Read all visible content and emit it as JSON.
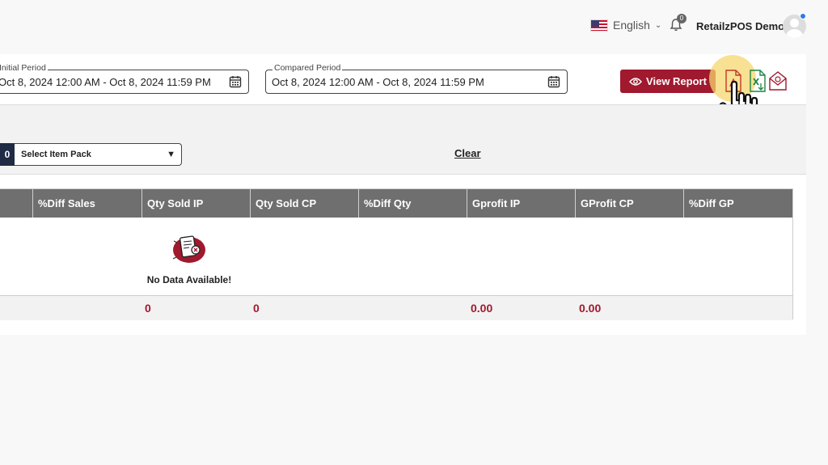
{
  "header": {
    "language": "English",
    "notifications_count": "0",
    "user_name": "RetailzPOS Demo"
  },
  "period": {
    "initial_label": "Initial Period",
    "initial_value": "Oct 8, 2024 12:00 AM - Oct 8, 2024 11:59 PM",
    "compared_label": "Compared Period",
    "compared_value": "Oct 8, 2024 12:00 AM - Oct 8, 2024 11:59 PM"
  },
  "actions": {
    "view_report": "View Report",
    "export_pdf": "pdf-export-icon",
    "export_excel": "excel-export-icon",
    "export_email": "email-export-icon"
  },
  "filters": {
    "item_pack_count": "0",
    "item_pack_placeholder": "Select Item Pack",
    "clear": "Clear"
  },
  "table": {
    "columns": [
      "%Diff Sales",
      "Qty Sold IP",
      "Qty Sold CP",
      "%Diff Qty",
      "Gprofit IP",
      "GProfit CP",
      "%Diff GP"
    ],
    "empty_message": "No Data Available!",
    "totals": {
      "qty_sold_ip": "0",
      "qty_sold_cp": "0",
      "gprofit_ip": "0.00",
      "gprofit_cp": "0.00"
    }
  },
  "colors": {
    "brand": "#a0192e",
    "header_bg": "#6f6f6f",
    "cursor_highlight": "#f5d76e"
  }
}
